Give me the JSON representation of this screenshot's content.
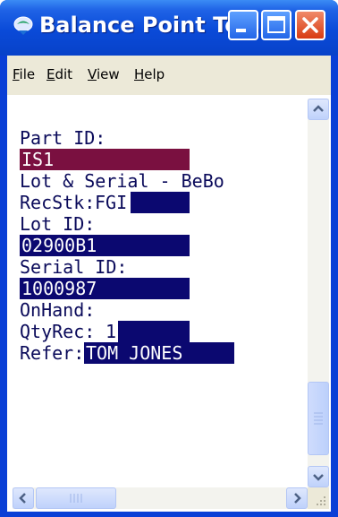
{
  "window": {
    "title": "Balance Point Tec...",
    "colors": {
      "titlebar": "#0a4ad8",
      "menubar": "#ece9d8",
      "field_active": "#7a1040",
      "field": "#0b0870",
      "text": "#0a0a5a"
    }
  },
  "menu": {
    "items": [
      {
        "label": "File",
        "accel": "F",
        "rest": "ile"
      },
      {
        "label": "Edit",
        "accel": "E",
        "rest": "dit"
      },
      {
        "label": "View",
        "accel": "V",
        "rest": "iew"
      },
      {
        "label": "Help",
        "accel": "H",
        "rest": "elp"
      }
    ]
  },
  "form": {
    "part_id_label": "Part ID:",
    "part_id_value": "IS1",
    "lot_serial_line": "Lot & Serial - BeBo",
    "recstk_label": "RecStk:",
    "recstk_value": "FGI",
    "lot_id_label": "Lot ID:",
    "lot_id_value": "02900B1",
    "serial_id_label": "Serial ID:",
    "serial_id_value": "1000987",
    "onhand_label": "OnHand:",
    "qtyrec_label": "QtyRec:",
    "qtyrec_value": "1",
    "refer_label": "Refer:",
    "refer_value": "TOM JONES"
  },
  "icons": {
    "app": "app-icon",
    "minimize": "minimize-icon",
    "maximize": "maximize-icon",
    "close": "close-icon",
    "scroll_up": "chevron-up-icon",
    "scroll_down": "chevron-down-icon",
    "scroll_left": "chevron-left-icon",
    "scroll_right": "chevron-right-icon",
    "grip": "resize-grip-icon"
  }
}
